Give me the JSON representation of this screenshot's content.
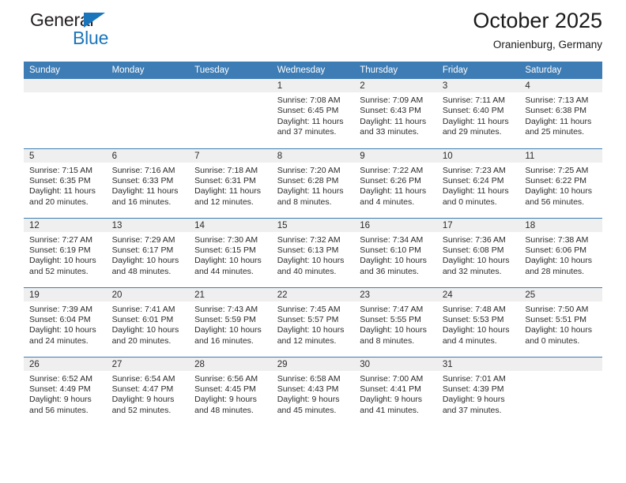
{
  "logo": {
    "word_top": "General",
    "word_bottom": "Blue",
    "triangle_color": "#1b75bb",
    "text_color": "#231f20"
  },
  "header": {
    "title": "October 2025",
    "subtitle": "Oranienburg, Germany"
  },
  "theme": {
    "header_bar_color": "#3d7cb4",
    "daynum_band_color": "#efefef",
    "cell_background": "#ffffff",
    "text_color": "#2b2b2b"
  },
  "weekday_headers": [
    "Sunday",
    "Monday",
    "Tuesday",
    "Wednesday",
    "Thursday",
    "Friday",
    "Saturday"
  ],
  "weeks": [
    [
      {
        "day": "",
        "empty": true
      },
      {
        "day": "",
        "empty": true
      },
      {
        "day": "",
        "empty": true
      },
      {
        "day": "1",
        "sunrise": "Sunrise: 7:08 AM",
        "sunset": "Sunset: 6:45 PM",
        "daylight1": "Daylight: 11 hours",
        "daylight2": "and 37 minutes."
      },
      {
        "day": "2",
        "sunrise": "Sunrise: 7:09 AM",
        "sunset": "Sunset: 6:43 PM",
        "daylight1": "Daylight: 11 hours",
        "daylight2": "and 33 minutes."
      },
      {
        "day": "3",
        "sunrise": "Sunrise: 7:11 AM",
        "sunset": "Sunset: 6:40 PM",
        "daylight1": "Daylight: 11 hours",
        "daylight2": "and 29 minutes."
      },
      {
        "day": "4",
        "sunrise": "Sunrise: 7:13 AM",
        "sunset": "Sunset: 6:38 PM",
        "daylight1": "Daylight: 11 hours",
        "daylight2": "and 25 minutes."
      }
    ],
    [
      {
        "day": "5",
        "sunrise": "Sunrise: 7:15 AM",
        "sunset": "Sunset: 6:35 PM",
        "daylight1": "Daylight: 11 hours",
        "daylight2": "and 20 minutes."
      },
      {
        "day": "6",
        "sunrise": "Sunrise: 7:16 AM",
        "sunset": "Sunset: 6:33 PM",
        "daylight1": "Daylight: 11 hours",
        "daylight2": "and 16 minutes."
      },
      {
        "day": "7",
        "sunrise": "Sunrise: 7:18 AM",
        "sunset": "Sunset: 6:31 PM",
        "daylight1": "Daylight: 11 hours",
        "daylight2": "and 12 minutes."
      },
      {
        "day": "8",
        "sunrise": "Sunrise: 7:20 AM",
        "sunset": "Sunset: 6:28 PM",
        "daylight1": "Daylight: 11 hours",
        "daylight2": "and 8 minutes."
      },
      {
        "day": "9",
        "sunrise": "Sunrise: 7:22 AM",
        "sunset": "Sunset: 6:26 PM",
        "daylight1": "Daylight: 11 hours",
        "daylight2": "and 4 minutes."
      },
      {
        "day": "10",
        "sunrise": "Sunrise: 7:23 AM",
        "sunset": "Sunset: 6:24 PM",
        "daylight1": "Daylight: 11 hours",
        "daylight2": "and 0 minutes."
      },
      {
        "day": "11",
        "sunrise": "Sunrise: 7:25 AM",
        "sunset": "Sunset: 6:22 PM",
        "daylight1": "Daylight: 10 hours",
        "daylight2": "and 56 minutes."
      }
    ],
    [
      {
        "day": "12",
        "sunrise": "Sunrise: 7:27 AM",
        "sunset": "Sunset: 6:19 PM",
        "daylight1": "Daylight: 10 hours",
        "daylight2": "and 52 minutes."
      },
      {
        "day": "13",
        "sunrise": "Sunrise: 7:29 AM",
        "sunset": "Sunset: 6:17 PM",
        "daylight1": "Daylight: 10 hours",
        "daylight2": "and 48 minutes."
      },
      {
        "day": "14",
        "sunrise": "Sunrise: 7:30 AM",
        "sunset": "Sunset: 6:15 PM",
        "daylight1": "Daylight: 10 hours",
        "daylight2": "and 44 minutes."
      },
      {
        "day": "15",
        "sunrise": "Sunrise: 7:32 AM",
        "sunset": "Sunset: 6:13 PM",
        "daylight1": "Daylight: 10 hours",
        "daylight2": "and 40 minutes."
      },
      {
        "day": "16",
        "sunrise": "Sunrise: 7:34 AM",
        "sunset": "Sunset: 6:10 PM",
        "daylight1": "Daylight: 10 hours",
        "daylight2": "and 36 minutes."
      },
      {
        "day": "17",
        "sunrise": "Sunrise: 7:36 AM",
        "sunset": "Sunset: 6:08 PM",
        "daylight1": "Daylight: 10 hours",
        "daylight2": "and 32 minutes."
      },
      {
        "day": "18",
        "sunrise": "Sunrise: 7:38 AM",
        "sunset": "Sunset: 6:06 PM",
        "daylight1": "Daylight: 10 hours",
        "daylight2": "and 28 minutes."
      }
    ],
    [
      {
        "day": "19",
        "sunrise": "Sunrise: 7:39 AM",
        "sunset": "Sunset: 6:04 PM",
        "daylight1": "Daylight: 10 hours",
        "daylight2": "and 24 minutes."
      },
      {
        "day": "20",
        "sunrise": "Sunrise: 7:41 AM",
        "sunset": "Sunset: 6:01 PM",
        "daylight1": "Daylight: 10 hours",
        "daylight2": "and 20 minutes."
      },
      {
        "day": "21",
        "sunrise": "Sunrise: 7:43 AM",
        "sunset": "Sunset: 5:59 PM",
        "daylight1": "Daylight: 10 hours",
        "daylight2": "and 16 minutes."
      },
      {
        "day": "22",
        "sunrise": "Sunrise: 7:45 AM",
        "sunset": "Sunset: 5:57 PM",
        "daylight1": "Daylight: 10 hours",
        "daylight2": "and 12 minutes."
      },
      {
        "day": "23",
        "sunrise": "Sunrise: 7:47 AM",
        "sunset": "Sunset: 5:55 PM",
        "daylight1": "Daylight: 10 hours",
        "daylight2": "and 8 minutes."
      },
      {
        "day": "24",
        "sunrise": "Sunrise: 7:48 AM",
        "sunset": "Sunset: 5:53 PM",
        "daylight1": "Daylight: 10 hours",
        "daylight2": "and 4 minutes."
      },
      {
        "day": "25",
        "sunrise": "Sunrise: 7:50 AM",
        "sunset": "Sunset: 5:51 PM",
        "daylight1": "Daylight: 10 hours",
        "daylight2": "and 0 minutes."
      }
    ],
    [
      {
        "day": "26",
        "sunrise": "Sunrise: 6:52 AM",
        "sunset": "Sunset: 4:49 PM",
        "daylight1": "Daylight: 9 hours",
        "daylight2": "and 56 minutes."
      },
      {
        "day": "27",
        "sunrise": "Sunrise: 6:54 AM",
        "sunset": "Sunset: 4:47 PM",
        "daylight1": "Daylight: 9 hours",
        "daylight2": "and 52 minutes."
      },
      {
        "day": "28",
        "sunrise": "Sunrise: 6:56 AM",
        "sunset": "Sunset: 4:45 PM",
        "daylight1": "Daylight: 9 hours",
        "daylight2": "and 48 minutes."
      },
      {
        "day": "29",
        "sunrise": "Sunrise: 6:58 AM",
        "sunset": "Sunset: 4:43 PM",
        "daylight1": "Daylight: 9 hours",
        "daylight2": "and 45 minutes."
      },
      {
        "day": "30",
        "sunrise": "Sunrise: 7:00 AM",
        "sunset": "Sunset: 4:41 PM",
        "daylight1": "Daylight: 9 hours",
        "daylight2": "and 41 minutes."
      },
      {
        "day": "31",
        "sunrise": "Sunrise: 7:01 AM",
        "sunset": "Sunset: 4:39 PM",
        "daylight1": "Daylight: 9 hours",
        "daylight2": "and 37 minutes."
      },
      {
        "day": "",
        "empty": true
      }
    ]
  ]
}
